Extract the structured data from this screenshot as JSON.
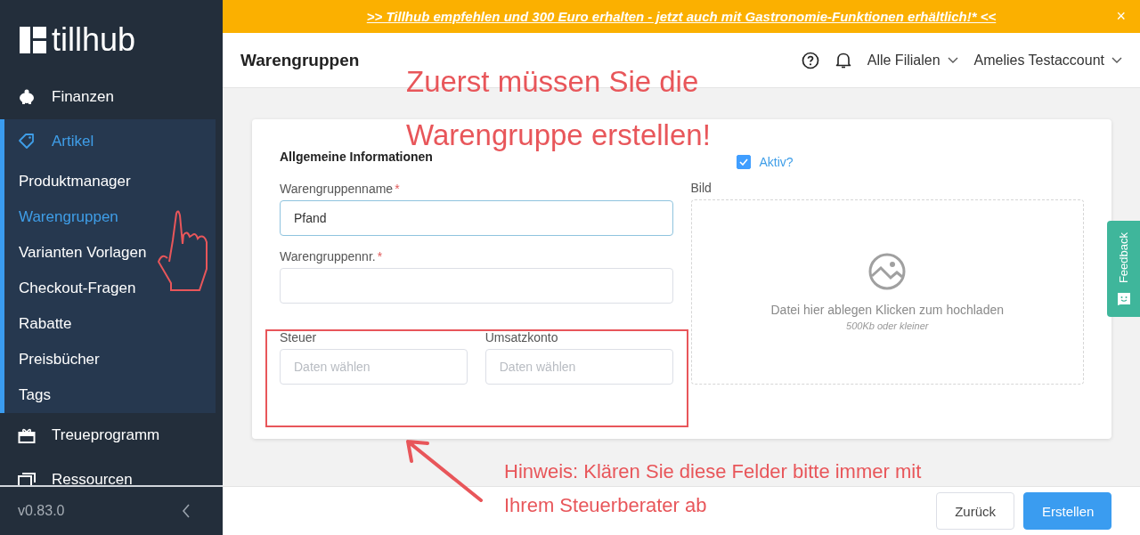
{
  "sidebar": {
    "logo": "tillhub",
    "items": [
      {
        "label": "Finanzen",
        "selected": false,
        "expanded": false
      },
      {
        "label": "Artikel",
        "selected": true,
        "expanded": true,
        "children": [
          {
            "label": "Produktmanager",
            "selected": false
          },
          {
            "label": "Warengruppen",
            "selected": true
          },
          {
            "label": "Varianten Vorlagen",
            "selected": false
          },
          {
            "label": "Checkout-Fragen",
            "selected": false
          },
          {
            "label": "Rabatte",
            "selected": false
          },
          {
            "label": "Preisbücher",
            "selected": false
          },
          {
            "label": "Tags",
            "selected": false
          }
        ]
      },
      {
        "label": "Treueprogramm",
        "selected": false,
        "expanded": false
      },
      {
        "label": "Ressourcen",
        "selected": false,
        "expanded": false
      }
    ],
    "version": "v0.83.0"
  },
  "banner": {
    "text": ">> Tillhub empfehlen und 300 Euro erhalten - jetzt auch mit Gastronomie-Funktionen erhältlich!* <<",
    "close": "×"
  },
  "header": {
    "title": "Warengruppen",
    "branch": "Alle Filialen",
    "account": "Amelies Testaccount"
  },
  "form": {
    "section_title": "Allgemeine Informationen",
    "active": {
      "label": "Aktiv?",
      "checked": true
    },
    "fields": [
      {
        "label": "Warengruppenname",
        "required_mark": "*",
        "value": "Pfand",
        "focused": true
      },
      {
        "label": "Warengruppennr.",
        "required_mark": "*",
        "focused": false
      }
    ],
    "selects": [
      {
        "label": "Steuer",
        "placeholder": "Daten wählen"
      },
      {
        "label": "Umsatzkonto",
        "placeholder": "Daten wählen"
      }
    ],
    "image": {
      "label": "Bild",
      "text": "Datei hier ablegen Klicken zum hochladen",
      "hint": "500Kb oder kleiner"
    }
  },
  "feedback": "Feedback",
  "buttons": [
    {
      "label": "Zurück",
      "kind": "secondary"
    },
    {
      "label": "Erstellen",
      "kind": "primary"
    }
  ],
  "annotations": {
    "title_lines": [
      "Zuerst müssen Sie die",
      "Warengruppe erstellen!"
    ],
    "hint_lines": [
      "Hinweis: Klären Sie diese Felder bitte immer mit",
      "Ihrem Steuerberater ab"
    ]
  }
}
